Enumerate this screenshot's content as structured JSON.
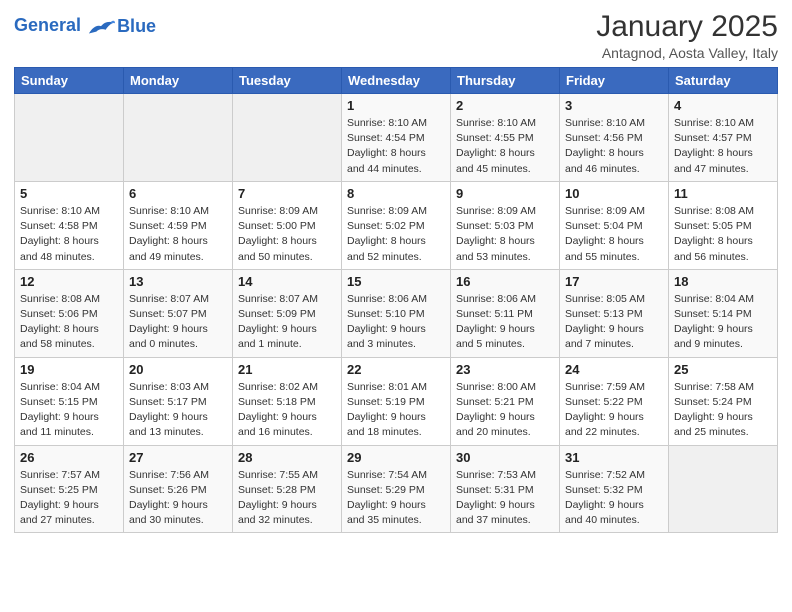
{
  "logo": {
    "line1": "General",
    "line2": "Blue"
  },
  "title": "January 2025",
  "subtitle": "Antagnod, Aosta Valley, Italy",
  "weekdays": [
    "Sunday",
    "Monday",
    "Tuesday",
    "Wednesday",
    "Thursday",
    "Friday",
    "Saturday"
  ],
  "weeks": [
    [
      {
        "day": "",
        "info": ""
      },
      {
        "day": "",
        "info": ""
      },
      {
        "day": "",
        "info": ""
      },
      {
        "day": "1",
        "info": "Sunrise: 8:10 AM\nSunset: 4:54 PM\nDaylight: 8 hours\nand 44 minutes."
      },
      {
        "day": "2",
        "info": "Sunrise: 8:10 AM\nSunset: 4:55 PM\nDaylight: 8 hours\nand 45 minutes."
      },
      {
        "day": "3",
        "info": "Sunrise: 8:10 AM\nSunset: 4:56 PM\nDaylight: 8 hours\nand 46 minutes."
      },
      {
        "day": "4",
        "info": "Sunrise: 8:10 AM\nSunset: 4:57 PM\nDaylight: 8 hours\nand 47 minutes."
      }
    ],
    [
      {
        "day": "5",
        "info": "Sunrise: 8:10 AM\nSunset: 4:58 PM\nDaylight: 8 hours\nand 48 minutes."
      },
      {
        "day": "6",
        "info": "Sunrise: 8:10 AM\nSunset: 4:59 PM\nDaylight: 8 hours\nand 49 minutes."
      },
      {
        "day": "7",
        "info": "Sunrise: 8:09 AM\nSunset: 5:00 PM\nDaylight: 8 hours\nand 50 minutes."
      },
      {
        "day": "8",
        "info": "Sunrise: 8:09 AM\nSunset: 5:02 PM\nDaylight: 8 hours\nand 52 minutes."
      },
      {
        "day": "9",
        "info": "Sunrise: 8:09 AM\nSunset: 5:03 PM\nDaylight: 8 hours\nand 53 minutes."
      },
      {
        "day": "10",
        "info": "Sunrise: 8:09 AM\nSunset: 5:04 PM\nDaylight: 8 hours\nand 55 minutes."
      },
      {
        "day": "11",
        "info": "Sunrise: 8:08 AM\nSunset: 5:05 PM\nDaylight: 8 hours\nand 56 minutes."
      }
    ],
    [
      {
        "day": "12",
        "info": "Sunrise: 8:08 AM\nSunset: 5:06 PM\nDaylight: 8 hours\nand 58 minutes."
      },
      {
        "day": "13",
        "info": "Sunrise: 8:07 AM\nSunset: 5:07 PM\nDaylight: 9 hours\nand 0 minutes."
      },
      {
        "day": "14",
        "info": "Sunrise: 8:07 AM\nSunset: 5:09 PM\nDaylight: 9 hours\nand 1 minute."
      },
      {
        "day": "15",
        "info": "Sunrise: 8:06 AM\nSunset: 5:10 PM\nDaylight: 9 hours\nand 3 minutes."
      },
      {
        "day": "16",
        "info": "Sunrise: 8:06 AM\nSunset: 5:11 PM\nDaylight: 9 hours\nand 5 minutes."
      },
      {
        "day": "17",
        "info": "Sunrise: 8:05 AM\nSunset: 5:13 PM\nDaylight: 9 hours\nand 7 minutes."
      },
      {
        "day": "18",
        "info": "Sunrise: 8:04 AM\nSunset: 5:14 PM\nDaylight: 9 hours\nand 9 minutes."
      }
    ],
    [
      {
        "day": "19",
        "info": "Sunrise: 8:04 AM\nSunset: 5:15 PM\nDaylight: 9 hours\nand 11 minutes."
      },
      {
        "day": "20",
        "info": "Sunrise: 8:03 AM\nSunset: 5:17 PM\nDaylight: 9 hours\nand 13 minutes."
      },
      {
        "day": "21",
        "info": "Sunrise: 8:02 AM\nSunset: 5:18 PM\nDaylight: 9 hours\nand 16 minutes."
      },
      {
        "day": "22",
        "info": "Sunrise: 8:01 AM\nSunset: 5:19 PM\nDaylight: 9 hours\nand 18 minutes."
      },
      {
        "day": "23",
        "info": "Sunrise: 8:00 AM\nSunset: 5:21 PM\nDaylight: 9 hours\nand 20 minutes."
      },
      {
        "day": "24",
        "info": "Sunrise: 7:59 AM\nSunset: 5:22 PM\nDaylight: 9 hours\nand 22 minutes."
      },
      {
        "day": "25",
        "info": "Sunrise: 7:58 AM\nSunset: 5:24 PM\nDaylight: 9 hours\nand 25 minutes."
      }
    ],
    [
      {
        "day": "26",
        "info": "Sunrise: 7:57 AM\nSunset: 5:25 PM\nDaylight: 9 hours\nand 27 minutes."
      },
      {
        "day": "27",
        "info": "Sunrise: 7:56 AM\nSunset: 5:26 PM\nDaylight: 9 hours\nand 30 minutes."
      },
      {
        "day": "28",
        "info": "Sunrise: 7:55 AM\nSunset: 5:28 PM\nDaylight: 9 hours\nand 32 minutes."
      },
      {
        "day": "29",
        "info": "Sunrise: 7:54 AM\nSunset: 5:29 PM\nDaylight: 9 hours\nand 35 minutes."
      },
      {
        "day": "30",
        "info": "Sunrise: 7:53 AM\nSunset: 5:31 PM\nDaylight: 9 hours\nand 37 minutes."
      },
      {
        "day": "31",
        "info": "Sunrise: 7:52 AM\nSunset: 5:32 PM\nDaylight: 9 hours\nand 40 minutes."
      },
      {
        "day": "",
        "info": ""
      }
    ]
  ]
}
